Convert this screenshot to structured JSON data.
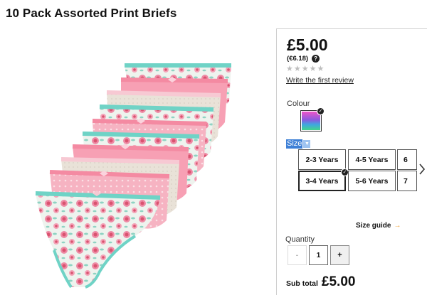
{
  "product": {
    "title": "10 Pack Assorted Print Briefs",
    "image_alt": "product-image",
    "price": "£5.00",
    "price_eur": "(€6.18)",
    "help_icon": "?",
    "rating_stars": 5,
    "rating_filled": 0,
    "review_link": "Write the first review"
  },
  "colour": {
    "label": "Colour",
    "selected_check": "✓"
  },
  "size": {
    "label": "Size",
    "options": [
      {
        "label": "2-3 Years",
        "selected": false
      },
      {
        "label": "4-5 Years",
        "selected": false
      },
      {
        "label": "6",
        "selected": false
      },
      {
        "label": "3-4 Years",
        "selected": true
      },
      {
        "label": "5-6 Years",
        "selected": false
      },
      {
        "label": "7",
        "selected": false
      }
    ],
    "guide_label": "Size guide",
    "guide_arrow": "→",
    "next_icon": "chevron-right-icon"
  },
  "quantity": {
    "label": "Quantity",
    "minus": "-",
    "value": "1",
    "plus": "+"
  },
  "subtotal": {
    "label": "Sub total",
    "value": "£5.00"
  },
  "colors": {
    "stripe_pink": "#f7a0b4",
    "stripe_teal": "#6fd3c6",
    "stripe_cream": "#ede6dd",
    "selection_blue": "#3d7fd6"
  }
}
